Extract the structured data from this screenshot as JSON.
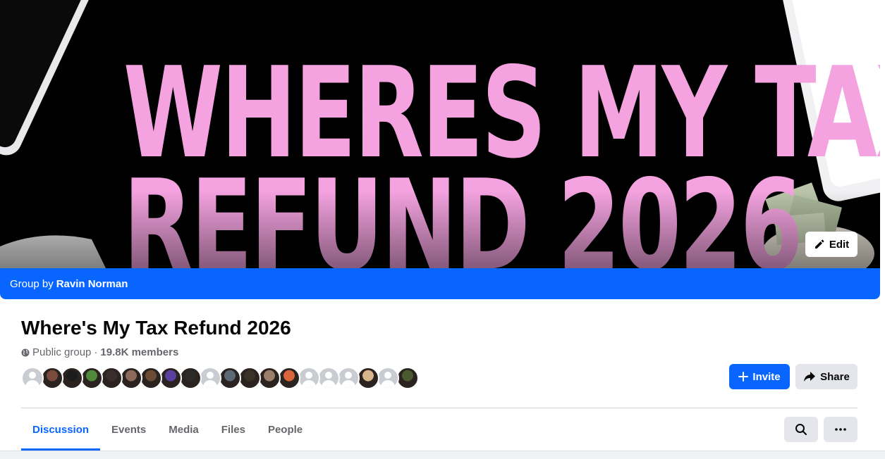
{
  "cover": {
    "title_line1": "WHERES MY TAX",
    "title_line2": "REFUND 2026",
    "edit_label": "Edit"
  },
  "banner": {
    "prefix": "Group by",
    "owner": "Ravin Norman"
  },
  "group": {
    "name": "Where's My Tax Refund 2026",
    "privacy": "Public group",
    "separator": "·",
    "members": "19.8K members"
  },
  "member_avatars": [
    {
      "type": "default"
    },
    {
      "type": "photo",
      "color": "#7a4a3c"
    },
    {
      "type": "photo",
      "color": "#1c1c1c"
    },
    {
      "type": "photo",
      "color": "#4f8a3a"
    },
    {
      "type": "photo",
      "color": "#3a2e2c"
    },
    {
      "type": "photo",
      "color": "#8d6a5a"
    },
    {
      "type": "photo",
      "color": "#6b4a36"
    },
    {
      "type": "photo",
      "color": "#5a3ea0"
    },
    {
      "type": "photo",
      "color": "#2d2a2a"
    },
    {
      "type": "default"
    },
    {
      "type": "photo",
      "color": "#5c6a78"
    },
    {
      "type": "photo",
      "color": "#3a3226"
    },
    {
      "type": "photo",
      "color": "#9b7f6a"
    },
    {
      "type": "photo",
      "color": "#d9653a"
    },
    {
      "type": "default"
    },
    {
      "type": "default"
    },
    {
      "type": "default"
    },
    {
      "type": "photo",
      "color": "#d8b58a"
    },
    {
      "type": "default"
    },
    {
      "type": "photo",
      "color": "#4a5a2e"
    }
  ],
  "actions": {
    "invite_label": "Invite",
    "share_label": "Share"
  },
  "tabs": [
    {
      "label": "Discussion",
      "active": true
    },
    {
      "label": "Events",
      "active": false
    },
    {
      "label": "Media",
      "active": false
    },
    {
      "label": "Files",
      "active": false
    },
    {
      "label": "People",
      "active": false
    }
  ],
  "colors": {
    "brand": "#0866ff",
    "cover_text": "#f4a3e0"
  }
}
